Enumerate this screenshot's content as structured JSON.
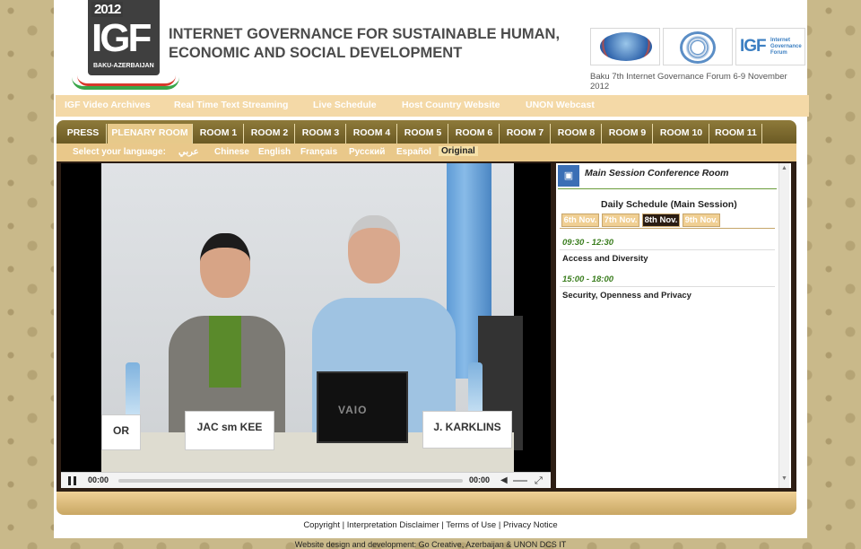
{
  "header": {
    "logo_year": "2012",
    "logo_text": "IGF",
    "logo_sub": "BAKU-AZERBAIJAN",
    "title_line1": "INTERNET GOVERNANCE FOR SUSTAINABLE HUMAN,",
    "title_line2": "ECONOMIC AND SOCIAL DEVELOPMENT",
    "forum_caption": "Baku 7th Internet Governance Forum 6-9 November 2012",
    "partner_igf_text": "IGF",
    "partner_igf_sub": "Internet Governance Forum"
  },
  "topnav": {
    "items": [
      "IGF Video Archives",
      "Real Time Text Streaming",
      "Live Schedule",
      "Host Country Website",
      "UNON Webcast"
    ]
  },
  "rooms": {
    "tabs": [
      "PRESS",
      "PLENARY ROOM",
      "ROOM 1",
      "ROOM 2",
      "ROOM 3",
      "ROOM 4",
      "ROOM 5",
      "ROOM 6",
      "ROOM 7",
      "ROOM 8",
      "ROOM 9",
      "ROOM 10",
      "ROOM 11"
    ],
    "active": "PLENARY ROOM"
  },
  "language": {
    "label": "Select your language:",
    "options": [
      "عربي",
      "Chinese",
      "English",
      "Français",
      "Русский",
      "Español"
    ],
    "selected": "Original"
  },
  "video": {
    "nameplate_left": "OR",
    "nameplate_center": "JAC sm KEE",
    "nameplate_right": "J. KARKLINS",
    "laptop_brand": "VAIO",
    "time_current": "00:00",
    "time_total": "00:00",
    "progress": 0
  },
  "schedule": {
    "room_title": "Main Session Conference Room",
    "title": "Daily Schedule (Main Session)",
    "days": [
      "6th Nov.",
      "7th Nov.",
      "8th Nov.",
      "9th Nov."
    ],
    "active_day": "8th Nov.",
    "slots": [
      {
        "time": "09:30 - 12:30",
        "title": "Access and Diversity"
      },
      {
        "time": "15:00 - 18:00",
        "title": "Security, Openness and Privacy"
      }
    ]
  },
  "footer": {
    "links": "Copyright | Interpretation Disclaimer | Terms of Use | Privacy Notice",
    "credit": "Website design and development: Go Creative, Azerbaijan & UNON DCS IT"
  }
}
